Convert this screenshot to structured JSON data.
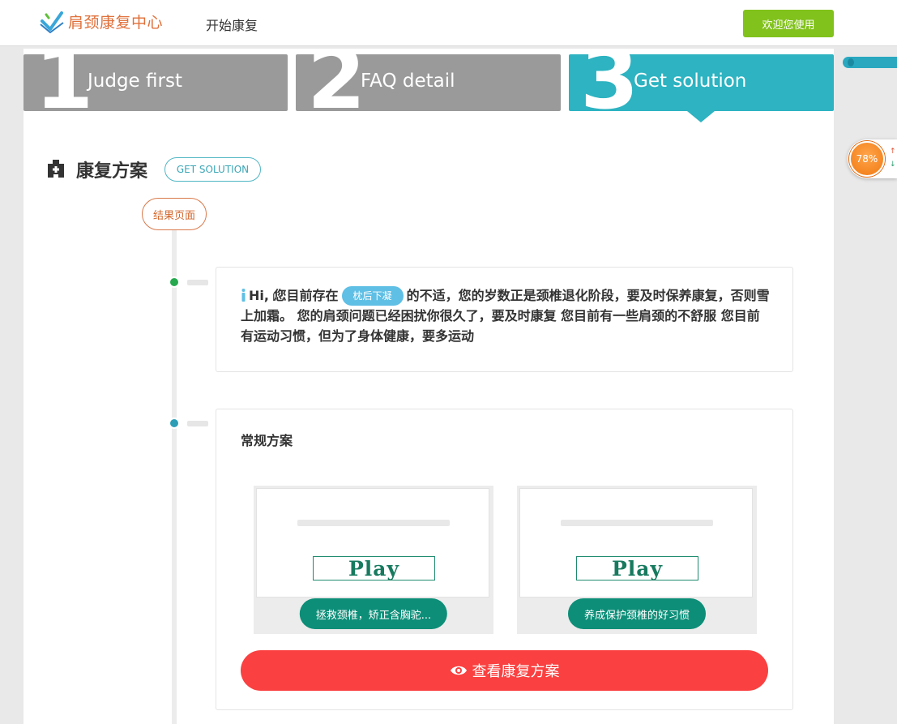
{
  "header": {
    "brand": "肩颈康复中心",
    "nav_link": "开始康复",
    "welcome_button": "欢迎您使用"
  },
  "steps": [
    {
      "number": "1",
      "label": "Judge first",
      "active": false
    },
    {
      "number": "2",
      "label": "FAQ detail",
      "active": false
    },
    {
      "number": "3",
      "label": "Get solution",
      "active": true
    }
  ],
  "section": {
    "title": "康复方案",
    "badge": "GET SOLUTION",
    "result_label": "结果页面"
  },
  "progress_widget": {
    "percent": "78%"
  },
  "message_card": {
    "greeting": "Hi,",
    "before_tag": "您目前存在",
    "tag": "枕后下凝",
    "after_tag": "的不适，您的岁数正是颈椎退化阶段，要及时保养康复，否则雪上加霜。 您的肩颈问题已经困扰你很久了，要及时康复 您目前有一些肩颈的不舒服 您目前有运动习惯，但为了身体健康，要多运动"
  },
  "plan_card": {
    "title": "常规方案",
    "videos": [
      {
        "play_label": "Play",
        "caption": "拯救颈椎，矫正含胸驼..."
      },
      {
        "play_label": "Play",
        "caption": "养成保护颈椎的好习惯"
      }
    ],
    "view_button": "查看康复方案"
  },
  "colors": {
    "brand_orange": "#e0703a",
    "welcome_green": "#82c21c",
    "step_inactive": "#9a9a9a",
    "step_active": "#2db3c1",
    "caption_green": "#0d8e78",
    "action_red": "#fa4040"
  }
}
